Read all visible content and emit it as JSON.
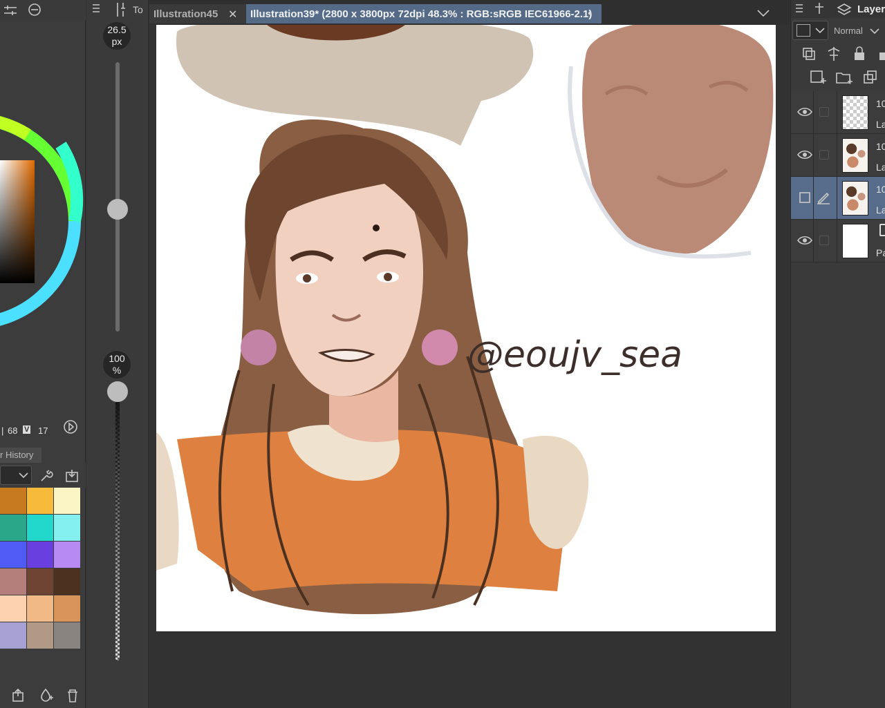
{
  "tabs": [
    {
      "label": "Illustration45",
      "active": false
    },
    {
      "label": "Illustration39* (2800 x 3800px 72dpi 48.3% : RGB:sRGB IEC61966-2.1)",
      "active": true,
      "modified_dot": "●"
    }
  ],
  "tool_header_label": "To",
  "brush_size": {
    "value": "26.5",
    "unit": "px",
    "level": 0.45
  },
  "brush_opacity": {
    "value": "100",
    "unit": "%",
    "level": 1.0
  },
  "color": {
    "readout": {
      "a": "68",
      "v_label": "V",
      "v": "17"
    },
    "current_hue_hex": "#e06a00"
  },
  "history_tab": "r History",
  "palette": [
    "#c87a20",
    "#f6bb3a",
    "#fbf5c6",
    "#2aa788",
    "#22d8cd",
    "#85f0f0",
    "#4f5bf4",
    "#6a3fe0",
    "#b689f3",
    "#b47e7a",
    "#6e4332",
    "#4c3120",
    "#fdd2b0",
    "#f1b986",
    "#d9945a",
    "#a7a0d2",
    "#b09a86",
    "#8a8480"
  ],
  "layer_panel": {
    "title": "Layer",
    "blend_mode": "Normal",
    "layers": [
      {
        "name_top": "10",
        "name_bottom": "La",
        "visible": true,
        "selected": false,
        "thumb": "transparent"
      },
      {
        "name_top": "10",
        "name_bottom": "La",
        "visible": true,
        "selected": false,
        "thumb": "sketch"
      },
      {
        "name_top": "10",
        "name_bottom": "La",
        "visible": false,
        "selected": true,
        "thumb": "sketch"
      },
      {
        "name_top": "",
        "name_bottom": "Pa",
        "visible": true,
        "selected": false,
        "thumb": "paper"
      }
    ]
  },
  "canvas": {
    "signature": "@eoujv_sea"
  }
}
